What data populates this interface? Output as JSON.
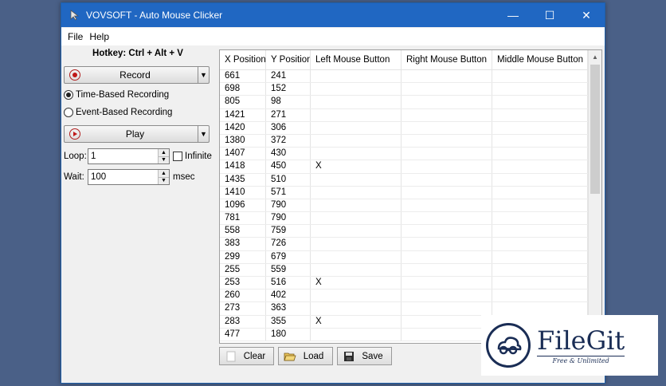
{
  "window": {
    "title": "VOVSOFT - Auto Mouse Clicker",
    "minimize": "—",
    "maximize": "☐",
    "close": "✕"
  },
  "menu": {
    "file": "File",
    "help": "Help"
  },
  "left_panel": {
    "hotkey": "Hotkey: Ctrl + Alt + V",
    "record_label": "Record",
    "time_based": "Time-Based Recording",
    "event_based": "Event-Based Recording",
    "selected_mode": "time_based",
    "play_label": "Play",
    "loop_label": "Loop:",
    "loop_value": "1",
    "infinite_label": "Infinite",
    "infinite_checked": false,
    "wait_label": "Wait:",
    "wait_value": "100",
    "wait_unit": "msec"
  },
  "table": {
    "columns": [
      "X Position",
      "Y Position",
      "Left Mouse Button",
      "Right Mouse Button",
      "Middle Mouse Button"
    ],
    "rows": [
      [
        "661",
        "241",
        "",
        "",
        ""
      ],
      [
        "698",
        "152",
        "",
        "",
        ""
      ],
      [
        "805",
        "98",
        "",
        "",
        ""
      ],
      [
        "1421",
        "271",
        "",
        "",
        ""
      ],
      [
        "1420",
        "306",
        "",
        "",
        ""
      ],
      [
        "1380",
        "372",
        "",
        "",
        ""
      ],
      [
        "1407",
        "430",
        "",
        "",
        ""
      ],
      [
        "1418",
        "450",
        "X",
        "",
        ""
      ],
      [
        "1435",
        "510",
        "",
        "",
        ""
      ],
      [
        "1410",
        "571",
        "",
        "",
        ""
      ],
      [
        "1096",
        "790",
        "",
        "",
        ""
      ],
      [
        "781",
        "790",
        "",
        "",
        ""
      ],
      [
        "558",
        "759",
        "",
        "",
        ""
      ],
      [
        "383",
        "726",
        "",
        "",
        ""
      ],
      [
        "299",
        "679",
        "",
        "",
        ""
      ],
      [
        "255",
        "559",
        "",
        "",
        ""
      ],
      [
        "253",
        "516",
        "X",
        "",
        ""
      ],
      [
        "260",
        "402",
        "",
        "",
        ""
      ],
      [
        "273",
        "363",
        "",
        "",
        ""
      ],
      [
        "283",
        "355",
        "X",
        "",
        ""
      ],
      [
        "477",
        "180",
        "",
        "",
        ""
      ]
    ]
  },
  "actions": {
    "clear": "Clear",
    "load": "Load",
    "save": "Save"
  },
  "watermark": {
    "name": "FileGit",
    "tagline": "Free & Unlimited"
  },
  "colors": {
    "titlebar": "#2067c2",
    "desktop": "#4a6087",
    "brand": "#1a2d55"
  }
}
